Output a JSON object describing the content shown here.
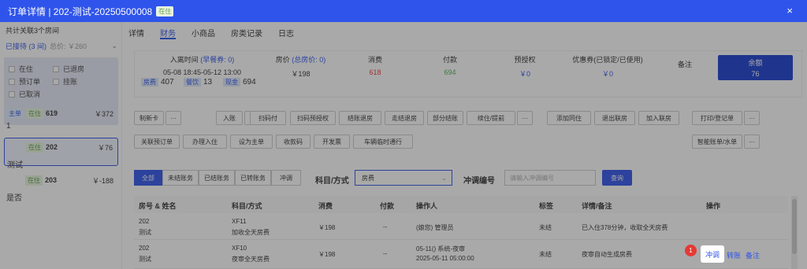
{
  "window": {
    "title": "订单详情 | 202-测试-20250500008",
    "status_badge": "在住",
    "close": "×"
  },
  "left": {
    "room_count": "共计关联3个房间",
    "selector_label": "已接待 (3 间)",
    "selector_total": "总价: ￥260",
    "filters": [
      "在住",
      "已退房",
      "预订单",
      "挂账",
      "已取消"
    ],
    "rooms": [
      {
        "tag1": "主单",
        "tag2": "在住",
        "number": "619",
        "amount": "￥372",
        "name": "1"
      },
      {
        "tag1": "",
        "tag2": "在住",
        "number": "202",
        "amount": "￥76",
        "name": "测试"
      },
      {
        "tag1": "",
        "tag2": "在住",
        "number": "203",
        "amount": "￥-188",
        "name": "是否"
      }
    ]
  },
  "tabs": [
    "详情",
    "财务",
    "小商品",
    "房类记录",
    "日志"
  ],
  "summary": {
    "checkin_label": "入离时间",
    "checkin_extra": "(早餐券: 0)",
    "checkin_value": "05-08 18:45-05-12 13:00",
    "room_price_label": "房价",
    "room_price_extra": "(总房价: 0)",
    "room_price_value": "￥198",
    "consume_label": "消费",
    "consume_value": "618",
    "pay_label": "付款",
    "pay_value": "694",
    "preauth_label": "预授权",
    "preauth_value": "￥0",
    "coupon_label": "优惠券(已锁定/已使用)",
    "coupon_value": "￥0",
    "note_label": "备注",
    "balance_label": "余额",
    "balance_value": "76",
    "mini": [
      {
        "tag": "房费",
        "value": "407"
      },
      {
        "tag": "餐饮",
        "value": "13"
      },
      {
        "tag": "现金",
        "value": "694"
      }
    ]
  },
  "actions": {
    "row1": [
      "制新卡",
      "···",
      "入账",
      "···",
      "扫码付",
      "扫码预授权",
      "结账退房",
      "走结退房",
      "部分结账",
      "续住/提前",
      "···",
      "添加同住",
      "退出联房",
      "加入联房",
      "打印/登记单",
      "···"
    ],
    "row2": [
      "关联预订单",
      "办理入住",
      "设为主单",
      "收款码",
      "开发票",
      "车辆临时通行",
      "智能账单/水单",
      "···"
    ]
  },
  "filter_bar": {
    "segments": [
      "全部",
      "未结账务",
      "已结账务",
      "已转账务",
      "冲调"
    ],
    "subject_label": "科目/方式",
    "subject_value": "房费",
    "adjust_label": "冲调编号",
    "adjust_placeholder": "请输入冲调编号",
    "query": "查询"
  },
  "table": {
    "headers": [
      "房号 & 姓名",
      "科目/方式",
      "消费",
      "付款",
      "操作人",
      "标签",
      "详情/备注",
      "操作"
    ],
    "rows": [
      {
        "room": "202",
        "name": "测试",
        "code": "XF11",
        "method": "加收全天房费",
        "consume": "￥198",
        "pay": "--",
        "operator": "(娘您) 管理员",
        "operator2": "",
        "tag": "未结",
        "detail": "已入住378分钟，收取全天房费"
      },
      {
        "room": "202",
        "name": "测试",
        "code": "XF10",
        "method": "夜审全天房费",
        "consume": "￥198",
        "pay": "--",
        "operator": "05-11() 系统-夜审",
        "operator2": "2025-05-11 05:00:00",
        "tag": "未结",
        "detail": "夜审自动生成房费"
      }
    ],
    "ops": {
      "highlight": "冲调",
      "transfer": "转账",
      "note": "备注",
      "step": "1"
    }
  }
}
